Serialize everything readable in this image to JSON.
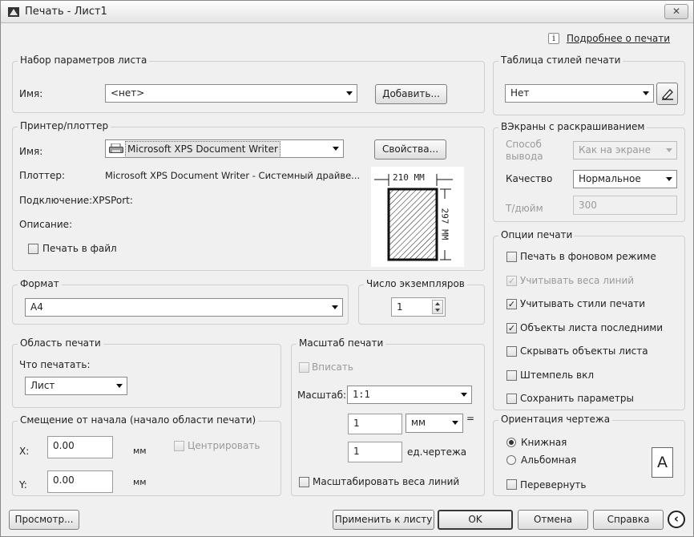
{
  "window": {
    "title": "Печать - Лист1",
    "close_label": "✕"
  },
  "help_link": "Подробнее о печати",
  "page_setup": {
    "legend": "Набор параметров листа",
    "name_label": "Имя:",
    "name_value": "<нет>",
    "add_button": "Добавить..."
  },
  "printer": {
    "legend": "Принтер/плоттер",
    "name_label": "Имя:",
    "name_value": "Microsoft XPS Document Writer",
    "properties_button": "Свойства...",
    "plotter_label": "Плоттер:",
    "plotter_value": "Microsoft XPS Document Writer - Системный драйве...",
    "connection_label": "Подключение:",
    "connection_value": "XPSPort:",
    "description_label": "Описание:",
    "print_to_file": {
      "label": "Печать в файл",
      "checked": false
    },
    "preview": {
      "width_text": "210 MM",
      "height_text": "297 MM"
    }
  },
  "paper_size": {
    "legend": "Формат",
    "value": "A4"
  },
  "copies": {
    "legend": "Число экземпляров",
    "value": "1"
  },
  "plot_area": {
    "legend": "Область печати",
    "what_label": "Что печатать:",
    "what_value": "Лист"
  },
  "offset": {
    "legend": "Смещение от начала (начало области печати)",
    "x_label": "X:",
    "x_value": "0.00",
    "x_unit": "мм",
    "y_label": "Y:",
    "y_value": "0.00",
    "y_unit": "мм",
    "center_label": "Центрировать"
  },
  "scale": {
    "legend": "Масштаб печати",
    "fit_label": "Вписать",
    "scale_label": "Масштаб:",
    "scale_value": "1:1",
    "value1": "1",
    "unit_value": "мм",
    "equals": "=",
    "value2": "1",
    "drawing_units": "ед.чертежа",
    "lineweights_label": "Масштабировать веса линий"
  },
  "style_table": {
    "legend": "Таблица стилей печати",
    "value": "Нет"
  },
  "shaded": {
    "legend": "ВЭкраны с раскрашиванием",
    "output_label": "Способ вывода",
    "output_value": "Как на экране",
    "quality_label": "Качество",
    "quality_value": "Нормальное",
    "dpi_label": "Т/дюйм",
    "dpi_value": "300"
  },
  "options": {
    "legend": "Опции печати",
    "items": [
      {
        "label": "Печать в фоновом режиме",
        "checked": false,
        "disabled": false
      },
      {
        "label": "Учитывать веса линий",
        "checked": true,
        "disabled": true
      },
      {
        "label": "Учитывать стили печати",
        "checked": true,
        "disabled": false
      },
      {
        "label": "Объекты листа последними",
        "checked": true,
        "disabled": false
      },
      {
        "label": "Скрывать объекты листа",
        "checked": false,
        "disabled": false
      },
      {
        "label": "Штемпель вкл",
        "checked": false,
        "disabled": false
      },
      {
        "label": "Сохранить параметры",
        "checked": false,
        "disabled": false
      }
    ]
  },
  "orientation": {
    "legend": "Ориентация чертежа",
    "portrait_label": "Книжная",
    "landscape_label": "Альбомная",
    "reverse_label": "Перевернуть",
    "icon_letter": "A"
  },
  "footer": {
    "preview_button": "Просмотр...",
    "apply_button": "Применить к листу",
    "ok_button": "OK",
    "cancel_button": "Отмена",
    "help_button": "Справка",
    "expand_icon": "‹"
  }
}
